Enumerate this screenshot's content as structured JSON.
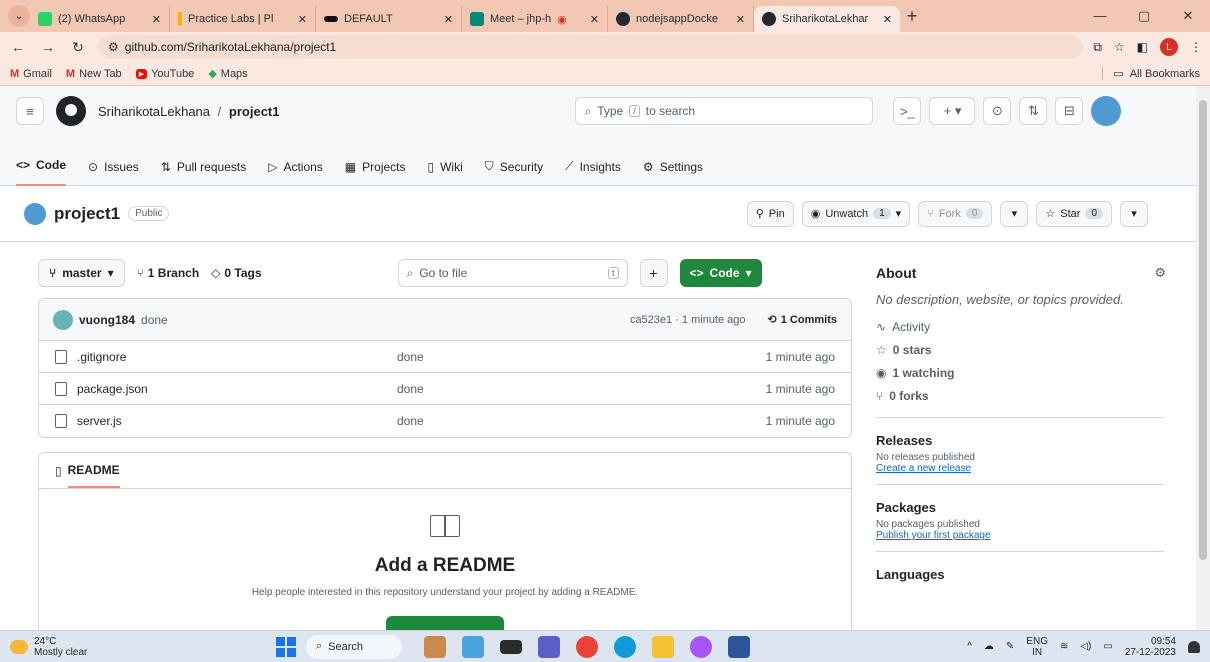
{
  "browser": {
    "tabs": [
      {
        "label": "(2) WhatsApp",
        "color": "#25d366"
      },
      {
        "label": "Practice Labs | Pl",
        "color": "#f4b400"
      },
      {
        "label": "DEFAULT",
        "color": "#111111"
      },
      {
        "label": "Meet – jhp-h",
        "color": "#00897b"
      },
      {
        "label": "nodejsappDocke",
        "color": "#24292f"
      },
      {
        "label": "SriharikotaLekhar",
        "color": "#24292f"
      }
    ],
    "url": "github.com/SriharikotaLekhana/project1",
    "profile_initial": "L",
    "bookmarks": [
      "Gmail",
      "New Tab",
      "YouTube",
      "Maps"
    ],
    "all_bookmarks": "All Bookmarks"
  },
  "header": {
    "owner": "SriharikotaLekhana",
    "separator": "/",
    "repo": "project1",
    "search_prefix": "Type",
    "search_key": "/",
    "search_suffix": "to search"
  },
  "repo_nav": [
    {
      "label": "Code",
      "icon": "<>"
    },
    {
      "label": "Issues",
      "icon": "⊙"
    },
    {
      "label": "Pull requests",
      "icon": "⇅"
    },
    {
      "label": "Actions",
      "icon": "▷"
    },
    {
      "label": "Projects",
      "icon": "▦"
    },
    {
      "label": "Wiki",
      "icon": "▯"
    },
    {
      "label": "Security",
      "icon": "⛉"
    },
    {
      "label": "Insights",
      "icon": "⟋"
    },
    {
      "label": "Settings",
      "icon": "⚙"
    }
  ],
  "repo": {
    "name": "project1",
    "visibility": "Public",
    "pin": "Pin",
    "unwatch": "Unwatch",
    "watch_count": "1",
    "fork": "Fork",
    "fork_count": "0",
    "star": "Star",
    "star_count": "0"
  },
  "toolbar": {
    "branch": "master",
    "branches": "1 Branch",
    "tags": "0 Tags",
    "goto_placeholder": "Go to file",
    "goto_key": "t",
    "code": "Code"
  },
  "commit": {
    "user": "vuong184",
    "message": "done",
    "meta": "ca523e1 · 1 minute ago",
    "count": "1 Commits"
  },
  "files": [
    {
      "name": ".gitignore",
      "message": "done",
      "time": "1 minute ago"
    },
    {
      "name": "package.json",
      "message": "done",
      "time": "1 minute ago"
    },
    {
      "name": "server.js",
      "message": "done",
      "time": "1 minute ago"
    }
  ],
  "readme": {
    "tab": "README",
    "title": "Add a README",
    "help": "Help people interested in this repository understand your project by adding a README."
  },
  "about": {
    "title": "About",
    "description": "No description, website, or topics provided.",
    "activity": "Activity",
    "stars": "0 stars",
    "watching": "1 watching",
    "forks": "0 forks"
  },
  "releases": {
    "title": "Releases",
    "none": "No releases published",
    "link": "Create a new release"
  },
  "packages": {
    "title": "Packages",
    "none": "No packages published",
    "link": "Publish your first package"
  },
  "languages": {
    "title": "Languages"
  },
  "taskbar": {
    "temp": "24°C",
    "condition": "Mostly clear",
    "search": "Search",
    "lang1": "ENG",
    "lang2": "IN",
    "time": "09:54",
    "date": "27-12-2023"
  }
}
